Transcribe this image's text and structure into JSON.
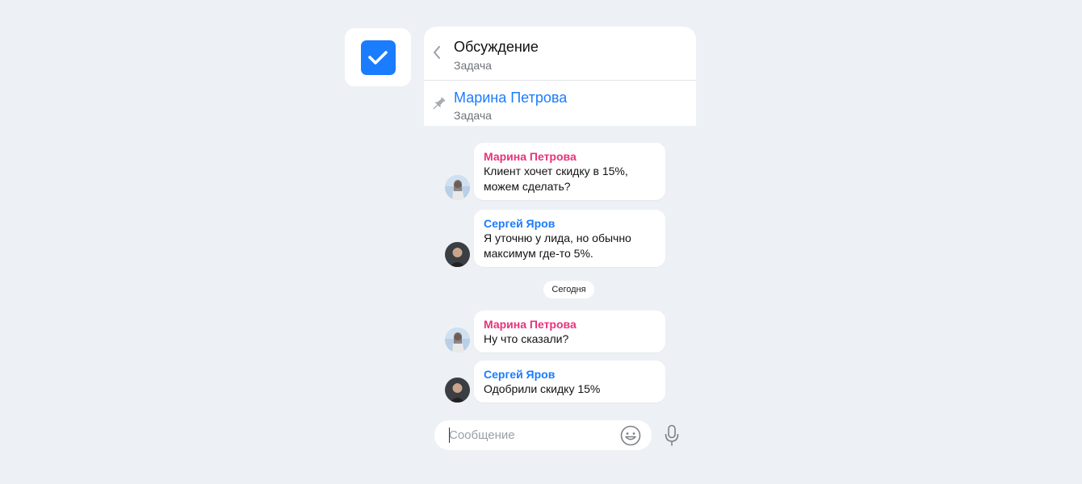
{
  "header": {
    "title": "Обсуждение",
    "subtitle": "Задача"
  },
  "pinned": {
    "name": "Марина Петрова",
    "subtitle": "Задача"
  },
  "messages": [
    {
      "author": "Марина Петрова",
      "text": "Клиент хочет скидку в 15%, можем сделать?",
      "author_color": "#e8327c"
    },
    {
      "author": "Сергей Яров",
      "text": "Я уточню у лида, но обычно максимум где-то 5%.",
      "author_color": "#1a7cff"
    },
    {
      "author": "Марина Петрова",
      "text": "Ну что сказали?",
      "author_color": "#e8327c"
    },
    {
      "author": "Сергей Яров",
      "text": "Одобрили скидку 15%",
      "author_color": "#1a7cff"
    }
  ],
  "date_separator": "Сегодня",
  "composer": {
    "placeholder": "Сообщение"
  },
  "icons": {
    "app": "checkbox-checked-icon",
    "back": "chevron-left-icon",
    "pin": "pin-icon",
    "emoji": "smiley-icon",
    "mic": "microphone-icon"
  },
  "colors": {
    "accent": "#1a7cff",
    "author_pink": "#e8327c",
    "background": "#edf1f5"
  }
}
